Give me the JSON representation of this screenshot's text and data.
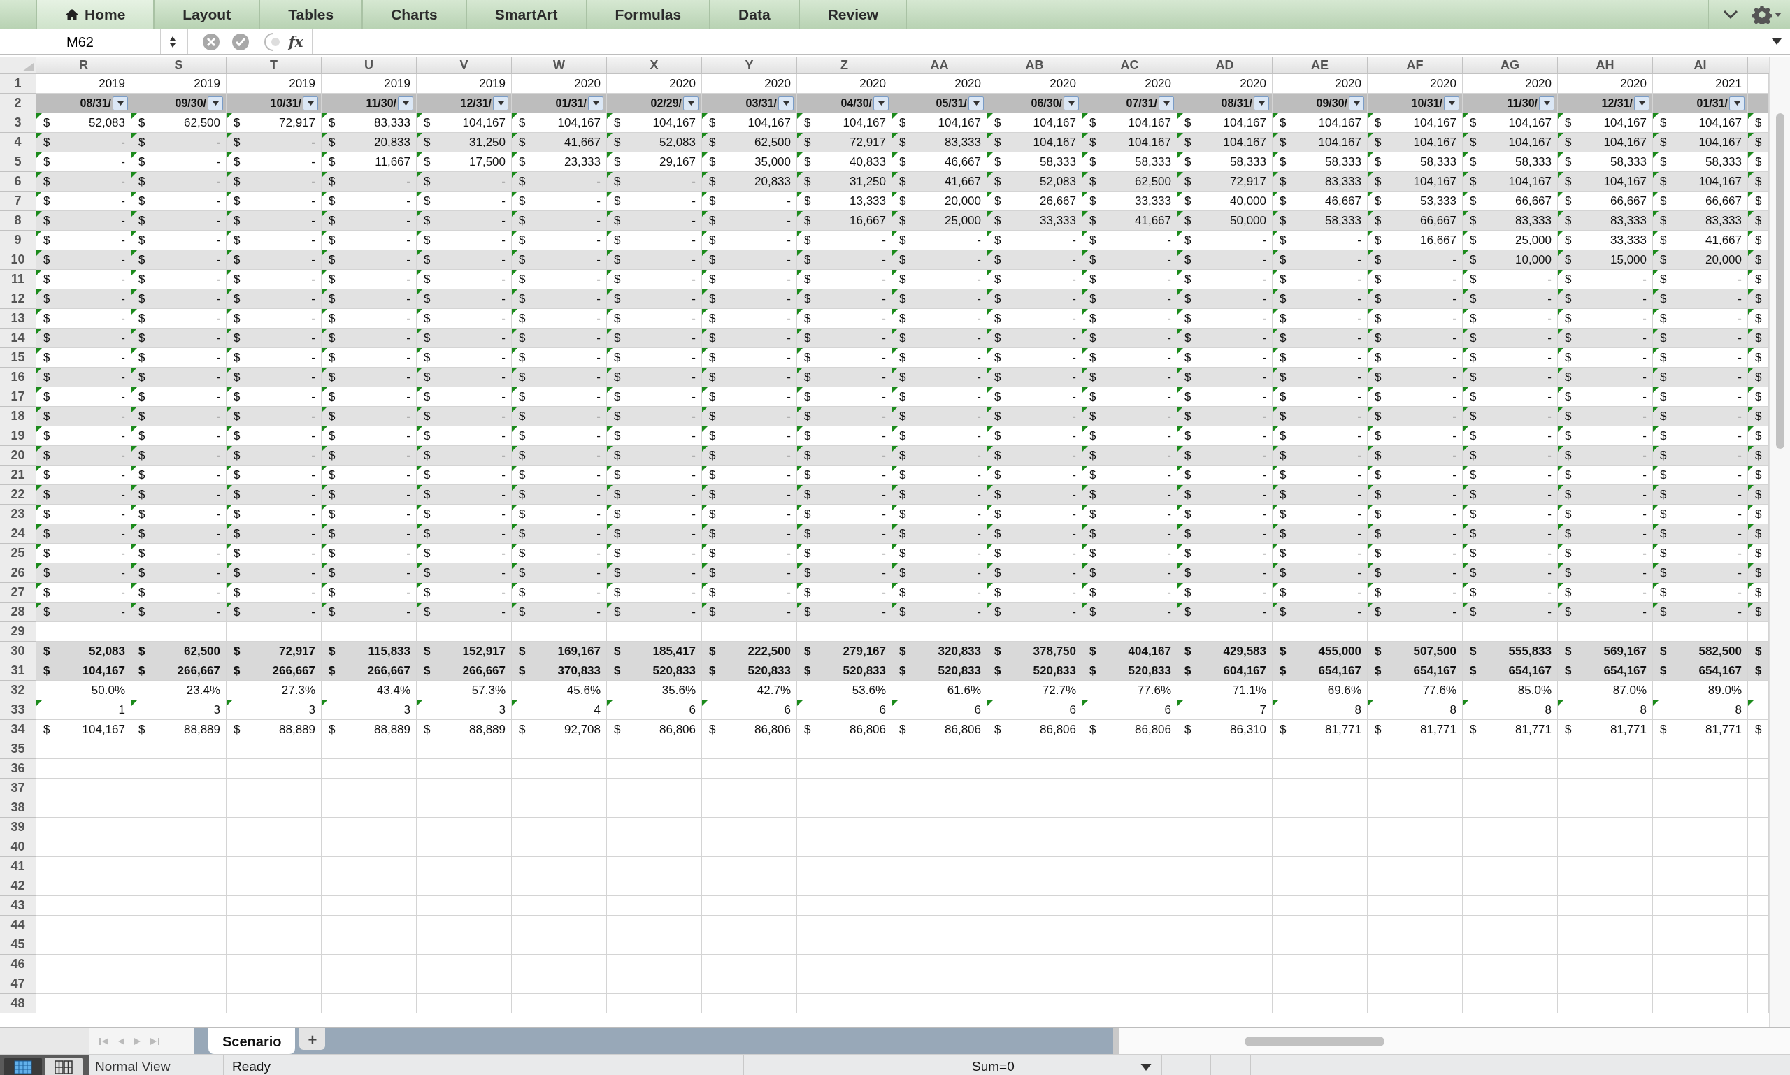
{
  "ribbon_tabs": [
    {
      "label": "Home",
      "selected": true,
      "kind": "home"
    },
    {
      "label": "Layout",
      "selected": false
    },
    {
      "label": "Tables",
      "selected": false
    },
    {
      "label": "Charts",
      "selected": false
    },
    {
      "label": "SmartArt",
      "selected": false
    },
    {
      "label": "Formulas",
      "selected": false
    },
    {
      "label": "Data",
      "selected": false
    },
    {
      "label": "Review",
      "selected": false
    }
  ],
  "formula_bar": {
    "name_box": "M62",
    "function_label": "fx"
  },
  "columns": [
    "R",
    "S",
    "T",
    "U",
    "V",
    "W",
    "X",
    "Y",
    "Z",
    "AA",
    "AB",
    "AC",
    "AD",
    "AE",
    "AF",
    "AG",
    "AH",
    "AI"
  ],
  "rows": [
    {
      "number": "1",
      "kind": "year",
      "flagged": false,
      "shaded": false,
      "cells": [
        "2019",
        "2019",
        "2019",
        "2019",
        "2019",
        "2020",
        "2020",
        "2020",
        "2020",
        "2020",
        "2020",
        "2020",
        "2020",
        "2020",
        "2020",
        "2020",
        "2020",
        "2021"
      ]
    },
    {
      "number": "2",
      "kind": "date",
      "flagged": false,
      "shaded": true,
      "cells": [
        "08/31/",
        "09/30/",
        "10/31/",
        "11/30/",
        "12/31/",
        "01/31/",
        "02/29/",
        "03/31/",
        "04/30/",
        "05/31/",
        "06/30/",
        "07/31/",
        "08/31/",
        "09/30/",
        "10/31/",
        "11/30/",
        "12/31/",
        "01/31/"
      ]
    },
    {
      "number": "3",
      "kind": "currency",
      "flagged": true,
      "shaded": false,
      "cells": [
        [
          "$",
          "52,083"
        ],
        [
          "$",
          "62,500"
        ],
        [
          "$",
          "72,917"
        ],
        [
          "$",
          "83,333"
        ],
        [
          "$",
          "104,167"
        ],
        [
          "$",
          "104,167"
        ],
        [
          "$",
          "104,167"
        ],
        [
          "$",
          "104,167"
        ],
        [
          "$",
          "104,167"
        ],
        [
          "$",
          "104,167"
        ],
        [
          "$",
          "104,167"
        ],
        [
          "$",
          "104,167"
        ],
        [
          "$",
          "104,167"
        ],
        [
          "$",
          "104,167"
        ],
        [
          "$",
          "104,167"
        ],
        [
          "$",
          "104,167"
        ],
        [
          "$",
          "104,167"
        ],
        [
          "$",
          "104,167"
        ],
        [
          "$"
        ]
      ]
    },
    {
      "number": "4",
      "kind": "currency",
      "flagged": true,
      "shaded": true,
      "cells": [
        [
          "$",
          "-"
        ],
        [
          "$",
          "-"
        ],
        [
          "$",
          "-"
        ],
        [
          "$",
          "20,833"
        ],
        [
          "$",
          "31,250"
        ],
        [
          "$",
          "41,667"
        ],
        [
          "$",
          "52,083"
        ],
        [
          "$",
          "62,500"
        ],
        [
          "$",
          "72,917"
        ],
        [
          "$",
          "83,333"
        ],
        [
          "$",
          "104,167"
        ],
        [
          "$",
          "104,167"
        ],
        [
          "$",
          "104,167"
        ],
        [
          "$",
          "104,167"
        ],
        [
          "$",
          "104,167"
        ],
        [
          "$",
          "104,167"
        ],
        [
          "$",
          "104,167"
        ],
        [
          "$",
          "104,167"
        ],
        [
          "$"
        ]
      ]
    },
    {
      "number": "5",
      "kind": "currency",
      "flagged": true,
      "shaded": false,
      "cells": [
        [
          "$",
          "-"
        ],
        [
          "$",
          "-"
        ],
        [
          "$",
          "-"
        ],
        [
          "$",
          "11,667"
        ],
        [
          "$",
          "17,500"
        ],
        [
          "$",
          "23,333"
        ],
        [
          "$",
          "29,167"
        ],
        [
          "$",
          "35,000"
        ],
        [
          "$",
          "40,833"
        ],
        [
          "$",
          "46,667"
        ],
        [
          "$",
          "58,333"
        ],
        [
          "$",
          "58,333"
        ],
        [
          "$",
          "58,333"
        ],
        [
          "$",
          "58,333"
        ],
        [
          "$",
          "58,333"
        ],
        [
          "$",
          "58,333"
        ],
        [
          "$",
          "58,333"
        ],
        [
          "$",
          "58,333"
        ],
        [
          "$"
        ]
      ]
    },
    {
      "number": "6",
      "kind": "currency",
      "flagged": true,
      "shaded": true,
      "cells": [
        [
          "$",
          "-"
        ],
        [
          "$",
          "-"
        ],
        [
          "$",
          "-"
        ],
        [
          "$",
          "-"
        ],
        [
          "$",
          "-"
        ],
        [
          "$",
          "-"
        ],
        [
          "$",
          "-"
        ],
        [
          "$",
          "20,833"
        ],
        [
          "$",
          "31,250"
        ],
        [
          "$",
          "41,667"
        ],
        [
          "$",
          "52,083"
        ],
        [
          "$",
          "62,500"
        ],
        [
          "$",
          "72,917"
        ],
        [
          "$",
          "83,333"
        ],
        [
          "$",
          "104,167"
        ],
        [
          "$",
          "104,167"
        ],
        [
          "$",
          "104,167"
        ],
        [
          "$",
          "104,167"
        ],
        [
          "$"
        ]
      ]
    },
    {
      "number": "7",
      "kind": "currency",
      "flagged": true,
      "shaded": false,
      "cells": [
        [
          "$",
          "-"
        ],
        [
          "$",
          "-"
        ],
        [
          "$",
          "-"
        ],
        [
          "$",
          "-"
        ],
        [
          "$",
          "-"
        ],
        [
          "$",
          "-"
        ],
        [
          "$",
          "-"
        ],
        [
          "$",
          "-"
        ],
        [
          "$",
          "13,333"
        ],
        [
          "$",
          "20,000"
        ],
        [
          "$",
          "26,667"
        ],
        [
          "$",
          "33,333"
        ],
        [
          "$",
          "40,000"
        ],
        [
          "$",
          "46,667"
        ],
        [
          "$",
          "53,333"
        ],
        [
          "$",
          "66,667"
        ],
        [
          "$",
          "66,667"
        ],
        [
          "$",
          "66,667"
        ],
        [
          "$"
        ]
      ]
    },
    {
      "number": "8",
      "kind": "currency",
      "flagged": true,
      "shaded": true,
      "cells": [
        [
          "$",
          "-"
        ],
        [
          "$",
          "-"
        ],
        [
          "$",
          "-"
        ],
        [
          "$",
          "-"
        ],
        [
          "$",
          "-"
        ],
        [
          "$",
          "-"
        ],
        [
          "$",
          "-"
        ],
        [
          "$",
          "-"
        ],
        [
          "$",
          "16,667"
        ],
        [
          "$",
          "25,000"
        ],
        [
          "$",
          "33,333"
        ],
        [
          "$",
          "41,667"
        ],
        [
          "$",
          "50,000"
        ],
        [
          "$",
          "58,333"
        ],
        [
          "$",
          "66,667"
        ],
        [
          "$",
          "83,333"
        ],
        [
          "$",
          "83,333"
        ],
        [
          "$",
          "83,333"
        ],
        [
          "$"
        ]
      ]
    },
    {
      "number": "9",
      "kind": "currency",
      "flagged": true,
      "shaded": false,
      "cells": [
        [
          "$",
          "-"
        ],
        [
          "$",
          "-"
        ],
        [
          "$",
          "-"
        ],
        [
          "$",
          "-"
        ],
        [
          "$",
          "-"
        ],
        [
          "$",
          "-"
        ],
        [
          "$",
          "-"
        ],
        [
          "$",
          "-"
        ],
        [
          "$",
          "-"
        ],
        [
          "$",
          "-"
        ],
        [
          "$",
          "-"
        ],
        [
          "$",
          "-"
        ],
        [
          "$",
          "-"
        ],
        [
          "$",
          "-"
        ],
        [
          "$",
          "16,667"
        ],
        [
          "$",
          "25,000"
        ],
        [
          "$",
          "33,333"
        ],
        [
          "$",
          "41,667"
        ],
        [
          "$"
        ]
      ]
    },
    {
      "number": "10",
      "kind": "currency",
      "flagged": true,
      "shaded": true,
      "cells": [
        [
          "$",
          "-"
        ],
        [
          "$",
          "-"
        ],
        [
          "$",
          "-"
        ],
        [
          "$",
          "-"
        ],
        [
          "$",
          "-"
        ],
        [
          "$",
          "-"
        ],
        [
          "$",
          "-"
        ],
        [
          "$",
          "-"
        ],
        [
          "$",
          "-"
        ],
        [
          "$",
          "-"
        ],
        [
          "$",
          "-"
        ],
        [
          "$",
          "-"
        ],
        [
          "$",
          "-"
        ],
        [
          "$",
          "-"
        ],
        [
          "$",
          "-"
        ],
        [
          "$",
          "10,000"
        ],
        [
          "$",
          "15,000"
        ],
        [
          "$",
          "20,000"
        ],
        [
          "$"
        ]
      ]
    },
    {
      "number": "11",
      "kind": "currency",
      "flagged": true,
      "shaded": false,
      "cells": [
        [
          "$",
          "-"
        ],
        [
          "$",
          "-"
        ],
        [
          "$",
          "-"
        ],
        [
          "$",
          "-"
        ],
        [
          "$",
          "-"
        ],
        [
          "$",
          "-"
        ],
        [
          "$",
          "-"
        ],
        [
          "$",
          "-"
        ],
        [
          "$",
          "-"
        ],
        [
          "$",
          "-"
        ],
        [
          "$",
          "-"
        ],
        [
          "$",
          "-"
        ],
        [
          "$",
          "-"
        ],
        [
          "$",
          "-"
        ],
        [
          "$",
          "-"
        ],
        [
          "$",
          "-"
        ],
        [
          "$",
          "-"
        ],
        [
          "$",
          "-"
        ],
        [
          "$"
        ]
      ]
    },
    {
      "number": "12",
      "kind": "currency",
      "flagged": true,
      "shaded": true,
      "cells": [
        [
          "$",
          "-"
        ],
        [
          "$",
          "-"
        ],
        [
          "$",
          "-"
        ],
        [
          "$",
          "-"
        ],
        [
          "$",
          "-"
        ],
        [
          "$",
          "-"
        ],
        [
          "$",
          "-"
        ],
        [
          "$",
          "-"
        ],
        [
          "$",
          "-"
        ],
        [
          "$",
          "-"
        ],
        [
          "$",
          "-"
        ],
        [
          "$",
          "-"
        ],
        [
          "$",
          "-"
        ],
        [
          "$",
          "-"
        ],
        [
          "$",
          "-"
        ],
        [
          "$",
          "-"
        ],
        [
          "$",
          "-"
        ],
        [
          "$",
          "-"
        ],
        [
          "$"
        ]
      ]
    },
    {
      "number": "13",
      "kind": "currency",
      "flagged": true,
      "shaded": false,
      "cells": [
        [
          "$",
          "-"
        ],
        [
          "$",
          "-"
        ],
        [
          "$",
          "-"
        ],
        [
          "$",
          "-"
        ],
        [
          "$",
          "-"
        ],
        [
          "$",
          "-"
        ],
        [
          "$",
          "-"
        ],
        [
          "$",
          "-"
        ],
        [
          "$",
          "-"
        ],
        [
          "$",
          "-"
        ],
        [
          "$",
          "-"
        ],
        [
          "$",
          "-"
        ],
        [
          "$",
          "-"
        ],
        [
          "$",
          "-"
        ],
        [
          "$",
          "-"
        ],
        [
          "$",
          "-"
        ],
        [
          "$",
          "-"
        ],
        [
          "$",
          "-"
        ],
        [
          "$"
        ]
      ]
    },
    {
      "number": "14",
      "kind": "currency",
      "flagged": true,
      "shaded": true,
      "cells": [
        [
          "$",
          "-"
        ],
        [
          "$",
          "-"
        ],
        [
          "$",
          "-"
        ],
        [
          "$",
          "-"
        ],
        [
          "$",
          "-"
        ],
        [
          "$",
          "-"
        ],
        [
          "$",
          "-"
        ],
        [
          "$",
          "-"
        ],
        [
          "$",
          "-"
        ],
        [
          "$",
          "-"
        ],
        [
          "$",
          "-"
        ],
        [
          "$",
          "-"
        ],
        [
          "$",
          "-"
        ],
        [
          "$",
          "-"
        ],
        [
          "$",
          "-"
        ],
        [
          "$",
          "-"
        ],
        [
          "$",
          "-"
        ],
        [
          "$",
          "-"
        ],
        [
          "$"
        ]
      ]
    },
    {
      "number": "15",
      "kind": "currency",
      "flagged": true,
      "shaded": false,
      "cells": [
        [
          "$",
          "-"
        ],
        [
          "$",
          "-"
        ],
        [
          "$",
          "-"
        ],
        [
          "$",
          "-"
        ],
        [
          "$",
          "-"
        ],
        [
          "$",
          "-"
        ],
        [
          "$",
          "-"
        ],
        [
          "$",
          "-"
        ],
        [
          "$",
          "-"
        ],
        [
          "$",
          "-"
        ],
        [
          "$",
          "-"
        ],
        [
          "$",
          "-"
        ],
        [
          "$",
          "-"
        ],
        [
          "$",
          "-"
        ],
        [
          "$",
          "-"
        ],
        [
          "$",
          "-"
        ],
        [
          "$",
          "-"
        ],
        [
          "$",
          "-"
        ],
        [
          "$"
        ]
      ]
    },
    {
      "number": "16",
      "kind": "currency",
      "flagged": true,
      "shaded": true,
      "cells": [
        [
          "$",
          "-"
        ],
        [
          "$",
          "-"
        ],
        [
          "$",
          "-"
        ],
        [
          "$",
          "-"
        ],
        [
          "$",
          "-"
        ],
        [
          "$",
          "-"
        ],
        [
          "$",
          "-"
        ],
        [
          "$",
          "-"
        ],
        [
          "$",
          "-"
        ],
        [
          "$",
          "-"
        ],
        [
          "$",
          "-"
        ],
        [
          "$",
          "-"
        ],
        [
          "$",
          "-"
        ],
        [
          "$",
          "-"
        ],
        [
          "$",
          "-"
        ],
        [
          "$",
          "-"
        ],
        [
          "$",
          "-"
        ],
        [
          "$",
          "-"
        ],
        [
          "$"
        ]
      ]
    },
    {
      "number": "17",
      "kind": "currency",
      "flagged": true,
      "shaded": false,
      "cells": [
        [
          "$",
          "-"
        ],
        [
          "$",
          "-"
        ],
        [
          "$",
          "-"
        ],
        [
          "$",
          "-"
        ],
        [
          "$",
          "-"
        ],
        [
          "$",
          "-"
        ],
        [
          "$",
          "-"
        ],
        [
          "$",
          "-"
        ],
        [
          "$",
          "-"
        ],
        [
          "$",
          "-"
        ],
        [
          "$",
          "-"
        ],
        [
          "$",
          "-"
        ],
        [
          "$",
          "-"
        ],
        [
          "$",
          "-"
        ],
        [
          "$",
          "-"
        ],
        [
          "$",
          "-"
        ],
        [
          "$",
          "-"
        ],
        [
          "$",
          "-"
        ],
        [
          "$"
        ]
      ]
    },
    {
      "number": "18",
      "kind": "currency",
      "flagged": true,
      "shaded": true,
      "cells": [
        [
          "$",
          "-"
        ],
        [
          "$",
          "-"
        ],
        [
          "$",
          "-"
        ],
        [
          "$",
          "-"
        ],
        [
          "$",
          "-"
        ],
        [
          "$",
          "-"
        ],
        [
          "$",
          "-"
        ],
        [
          "$",
          "-"
        ],
        [
          "$",
          "-"
        ],
        [
          "$",
          "-"
        ],
        [
          "$",
          "-"
        ],
        [
          "$",
          "-"
        ],
        [
          "$",
          "-"
        ],
        [
          "$",
          "-"
        ],
        [
          "$",
          "-"
        ],
        [
          "$",
          "-"
        ],
        [
          "$",
          "-"
        ],
        [
          "$",
          "-"
        ],
        [
          "$"
        ]
      ]
    },
    {
      "number": "19",
      "kind": "currency",
      "flagged": true,
      "shaded": false,
      "cells": [
        [
          "$",
          "-"
        ],
        [
          "$",
          "-"
        ],
        [
          "$",
          "-"
        ],
        [
          "$",
          "-"
        ],
        [
          "$",
          "-"
        ],
        [
          "$",
          "-"
        ],
        [
          "$",
          "-"
        ],
        [
          "$",
          "-"
        ],
        [
          "$",
          "-"
        ],
        [
          "$",
          "-"
        ],
        [
          "$",
          "-"
        ],
        [
          "$",
          "-"
        ],
        [
          "$",
          "-"
        ],
        [
          "$",
          "-"
        ],
        [
          "$",
          "-"
        ],
        [
          "$",
          "-"
        ],
        [
          "$",
          "-"
        ],
        [
          "$",
          "-"
        ],
        [
          "$"
        ]
      ]
    },
    {
      "number": "20",
      "kind": "currency",
      "flagged": true,
      "shaded": true,
      "cells": [
        [
          "$",
          "-"
        ],
        [
          "$",
          "-"
        ],
        [
          "$",
          "-"
        ],
        [
          "$",
          "-"
        ],
        [
          "$",
          "-"
        ],
        [
          "$",
          "-"
        ],
        [
          "$",
          "-"
        ],
        [
          "$",
          "-"
        ],
        [
          "$",
          "-"
        ],
        [
          "$",
          "-"
        ],
        [
          "$",
          "-"
        ],
        [
          "$",
          "-"
        ],
        [
          "$",
          "-"
        ],
        [
          "$",
          "-"
        ],
        [
          "$",
          "-"
        ],
        [
          "$",
          "-"
        ],
        [
          "$",
          "-"
        ],
        [
          "$",
          "-"
        ],
        [
          "$"
        ]
      ]
    },
    {
      "number": "21",
      "kind": "currency",
      "flagged": true,
      "shaded": false,
      "cells": [
        [
          "$",
          "-"
        ],
        [
          "$",
          "-"
        ],
        [
          "$",
          "-"
        ],
        [
          "$",
          "-"
        ],
        [
          "$",
          "-"
        ],
        [
          "$",
          "-"
        ],
        [
          "$",
          "-"
        ],
        [
          "$",
          "-"
        ],
        [
          "$",
          "-"
        ],
        [
          "$",
          "-"
        ],
        [
          "$",
          "-"
        ],
        [
          "$",
          "-"
        ],
        [
          "$",
          "-"
        ],
        [
          "$",
          "-"
        ],
        [
          "$",
          "-"
        ],
        [
          "$",
          "-"
        ],
        [
          "$",
          "-"
        ],
        [
          "$",
          "-"
        ],
        [
          "$"
        ]
      ]
    },
    {
      "number": "22",
      "kind": "currency",
      "flagged": true,
      "shaded": true,
      "cells": [
        [
          "$",
          "-"
        ],
        [
          "$",
          "-"
        ],
        [
          "$",
          "-"
        ],
        [
          "$",
          "-"
        ],
        [
          "$",
          "-"
        ],
        [
          "$",
          "-"
        ],
        [
          "$",
          "-"
        ],
        [
          "$",
          "-"
        ],
        [
          "$",
          "-"
        ],
        [
          "$",
          "-"
        ],
        [
          "$",
          "-"
        ],
        [
          "$",
          "-"
        ],
        [
          "$",
          "-"
        ],
        [
          "$",
          "-"
        ],
        [
          "$",
          "-"
        ],
        [
          "$",
          "-"
        ],
        [
          "$",
          "-"
        ],
        [
          "$",
          "-"
        ],
        [
          "$"
        ]
      ]
    },
    {
      "number": "23",
      "kind": "currency",
      "flagged": true,
      "shaded": false,
      "cells": [
        [
          "$",
          "-"
        ],
        [
          "$",
          "-"
        ],
        [
          "$",
          "-"
        ],
        [
          "$",
          "-"
        ],
        [
          "$",
          "-"
        ],
        [
          "$",
          "-"
        ],
        [
          "$",
          "-"
        ],
        [
          "$",
          "-"
        ],
        [
          "$",
          "-"
        ],
        [
          "$",
          "-"
        ],
        [
          "$",
          "-"
        ],
        [
          "$",
          "-"
        ],
        [
          "$",
          "-"
        ],
        [
          "$",
          "-"
        ],
        [
          "$",
          "-"
        ],
        [
          "$",
          "-"
        ],
        [
          "$",
          "-"
        ],
        [
          "$",
          "-"
        ],
        [
          "$"
        ]
      ]
    },
    {
      "number": "24",
      "kind": "currency",
      "flagged": true,
      "shaded": true,
      "cells": [
        [
          "$",
          "-"
        ],
        [
          "$",
          "-"
        ],
        [
          "$",
          "-"
        ],
        [
          "$",
          "-"
        ],
        [
          "$",
          "-"
        ],
        [
          "$",
          "-"
        ],
        [
          "$",
          "-"
        ],
        [
          "$",
          "-"
        ],
        [
          "$",
          "-"
        ],
        [
          "$",
          "-"
        ],
        [
          "$",
          "-"
        ],
        [
          "$",
          "-"
        ],
        [
          "$",
          "-"
        ],
        [
          "$",
          "-"
        ],
        [
          "$",
          "-"
        ],
        [
          "$",
          "-"
        ],
        [
          "$",
          "-"
        ],
        [
          "$",
          "-"
        ],
        [
          "$"
        ]
      ]
    },
    {
      "number": "25",
      "kind": "currency",
      "flagged": true,
      "shaded": false,
      "cells": [
        [
          "$",
          "-"
        ],
        [
          "$",
          "-"
        ],
        [
          "$",
          "-"
        ],
        [
          "$",
          "-"
        ],
        [
          "$",
          "-"
        ],
        [
          "$",
          "-"
        ],
        [
          "$",
          "-"
        ],
        [
          "$",
          "-"
        ],
        [
          "$",
          "-"
        ],
        [
          "$",
          "-"
        ],
        [
          "$",
          "-"
        ],
        [
          "$",
          "-"
        ],
        [
          "$",
          "-"
        ],
        [
          "$",
          "-"
        ],
        [
          "$",
          "-"
        ],
        [
          "$",
          "-"
        ],
        [
          "$",
          "-"
        ],
        [
          "$",
          "-"
        ],
        [
          "$"
        ]
      ]
    },
    {
      "number": "26",
      "kind": "currency",
      "flagged": true,
      "shaded": true,
      "cells": [
        [
          "$",
          "-"
        ],
        [
          "$",
          "-"
        ],
        [
          "$",
          "-"
        ],
        [
          "$",
          "-"
        ],
        [
          "$",
          "-"
        ],
        [
          "$",
          "-"
        ],
        [
          "$",
          "-"
        ],
        [
          "$",
          "-"
        ],
        [
          "$",
          "-"
        ],
        [
          "$",
          "-"
        ],
        [
          "$",
          "-"
        ],
        [
          "$",
          "-"
        ],
        [
          "$",
          "-"
        ],
        [
          "$",
          "-"
        ],
        [
          "$",
          "-"
        ],
        [
          "$",
          "-"
        ],
        [
          "$",
          "-"
        ],
        [
          "$",
          "-"
        ],
        [
          "$"
        ]
      ]
    },
    {
      "number": "27",
      "kind": "currency",
      "flagged": true,
      "shaded": false,
      "cells": [
        [
          "$",
          "-"
        ],
        [
          "$",
          "-"
        ],
        [
          "$",
          "-"
        ],
        [
          "$",
          "-"
        ],
        [
          "$",
          "-"
        ],
        [
          "$",
          "-"
        ],
        [
          "$",
          "-"
        ],
        [
          "$",
          "-"
        ],
        [
          "$",
          "-"
        ],
        [
          "$",
          "-"
        ],
        [
          "$",
          "-"
        ],
        [
          "$",
          "-"
        ],
        [
          "$",
          "-"
        ],
        [
          "$",
          "-"
        ],
        [
          "$",
          "-"
        ],
        [
          "$",
          "-"
        ],
        [
          "$",
          "-"
        ],
        [
          "$",
          "-"
        ],
        [
          "$"
        ]
      ]
    },
    {
      "number": "28",
      "kind": "currency",
      "flagged": true,
      "shaded": true,
      "cells": [
        [
          "$",
          "-"
        ],
        [
          "$",
          "-"
        ],
        [
          "$",
          "-"
        ],
        [
          "$",
          "-"
        ],
        [
          "$",
          "-"
        ],
        [
          "$",
          "-"
        ],
        [
          "$",
          "-"
        ],
        [
          "$",
          "-"
        ],
        [
          "$",
          "-"
        ],
        [
          "$",
          "-"
        ],
        [
          "$",
          "-"
        ],
        [
          "$",
          "-"
        ],
        [
          "$",
          "-"
        ],
        [
          "$",
          "-"
        ],
        [
          "$",
          "-"
        ],
        [
          "$",
          "-"
        ],
        [
          "$",
          "-"
        ],
        [
          "$",
          "-"
        ],
        [
          "$"
        ]
      ]
    },
    {
      "number": "29",
      "kind": "empty"
    },
    {
      "number": "30",
      "kind": "total",
      "flagged": false,
      "shaded": true,
      "cells": [
        [
          "$",
          "52,083"
        ],
        [
          "$",
          "62,500"
        ],
        [
          "$",
          "72,917"
        ],
        [
          "$",
          "115,833"
        ],
        [
          "$",
          "152,917"
        ],
        [
          "$",
          "169,167"
        ],
        [
          "$",
          "185,417"
        ],
        [
          "$",
          "222,500"
        ],
        [
          "$",
          "279,167"
        ],
        [
          "$",
          "320,833"
        ],
        [
          "$",
          "378,750"
        ],
        [
          "$",
          "404,167"
        ],
        [
          "$",
          "429,583"
        ],
        [
          "$",
          "455,000"
        ],
        [
          "$",
          "507,500"
        ],
        [
          "$",
          "555,833"
        ],
        [
          "$",
          "569,167"
        ],
        [
          "$",
          "582,500"
        ],
        [
          "$"
        ]
      ]
    },
    {
      "number": "31",
      "kind": "total",
      "flagged": false,
      "shaded": true,
      "cells": [
        [
          "$",
          "104,167"
        ],
        [
          "$",
          "266,667"
        ],
        [
          "$",
          "266,667"
        ],
        [
          "$",
          "266,667"
        ],
        [
          "$",
          "266,667"
        ],
        [
          "$",
          "370,833"
        ],
        [
          "$",
          "520,833"
        ],
        [
          "$",
          "520,833"
        ],
        [
          "$",
          "520,833"
        ],
        [
          "$",
          "520,833"
        ],
        [
          "$",
          "520,833"
        ],
        [
          "$",
          "520,833"
        ],
        [
          "$",
          "604,167"
        ],
        [
          "$",
          "654,167"
        ],
        [
          "$",
          "654,167"
        ],
        [
          "$",
          "654,167"
        ],
        [
          "$",
          "654,167"
        ],
        [
          "$",
          "654,167"
        ],
        [
          "$"
        ]
      ]
    },
    {
      "number": "32",
      "kind": "plain",
      "flagged": false,
      "shaded": false,
      "cells": [
        "50.0%",
        "23.4%",
        "27.3%",
        "43.4%",
        "57.3%",
        "45.6%",
        "35.6%",
        "42.7%",
        "53.6%",
        "61.6%",
        "72.7%",
        "77.6%",
        "71.1%",
        "69.6%",
        "77.6%",
        "85.0%",
        "87.0%",
        "89.0%"
      ]
    },
    {
      "number": "33",
      "kind": "plain",
      "flagged": true,
      "shaded": false,
      "cells": [
        "1",
        "3",
        "3",
        "3",
        "3",
        "4",
        "6",
        "6",
        "6",
        "6",
        "6",
        "6",
        "7",
        "8",
        "8",
        "8",
        "8",
        "8"
      ]
    },
    {
      "number": "34",
      "kind": "currency",
      "flagged": false,
      "shaded": false,
      "cells": [
        [
          "$",
          "104,167"
        ],
        [
          "$",
          "88,889"
        ],
        [
          "$",
          "88,889"
        ],
        [
          "$",
          "88,889"
        ],
        [
          "$",
          "88,889"
        ],
        [
          "$",
          "92,708"
        ],
        [
          "$",
          "86,806"
        ],
        [
          "$",
          "86,806"
        ],
        [
          "$",
          "86,806"
        ],
        [
          "$",
          "86,806"
        ],
        [
          "$",
          "86,806"
        ],
        [
          "$",
          "86,806"
        ],
        [
          "$",
          "86,310"
        ],
        [
          "$",
          "81,771"
        ],
        [
          "$",
          "81,771"
        ],
        [
          "$",
          "81,771"
        ],
        [
          "$",
          "81,771"
        ],
        [
          "$",
          "81,771"
        ],
        [
          "$"
        ]
      ]
    },
    {
      "number": "35",
      "kind": "empty"
    },
    {
      "number": "36",
      "kind": "empty"
    },
    {
      "number": "37",
      "kind": "empty"
    },
    {
      "number": "38",
      "kind": "empty"
    },
    {
      "number": "39",
      "kind": "empty"
    },
    {
      "number": "40",
      "kind": "empty"
    },
    {
      "number": "41",
      "kind": "empty"
    },
    {
      "number": "42",
      "kind": "empty"
    },
    {
      "number": "43",
      "kind": "empty"
    },
    {
      "number": "44",
      "kind": "empty"
    },
    {
      "number": "45",
      "kind": "empty"
    },
    {
      "number": "46",
      "kind": "empty"
    },
    {
      "number": "47",
      "kind": "empty"
    },
    {
      "number": "48",
      "kind": "empty"
    }
  ],
  "sheet_tabs": [
    {
      "label": "Scenario",
      "selected": true
    }
  ],
  "new_sheet_label": "+",
  "status_bar": {
    "views": [
      {
        "selected": true
      },
      {
        "selected": false
      }
    ],
    "view_label": "Normal View",
    "status": "Ready",
    "sum": "Sum=0"
  }
}
